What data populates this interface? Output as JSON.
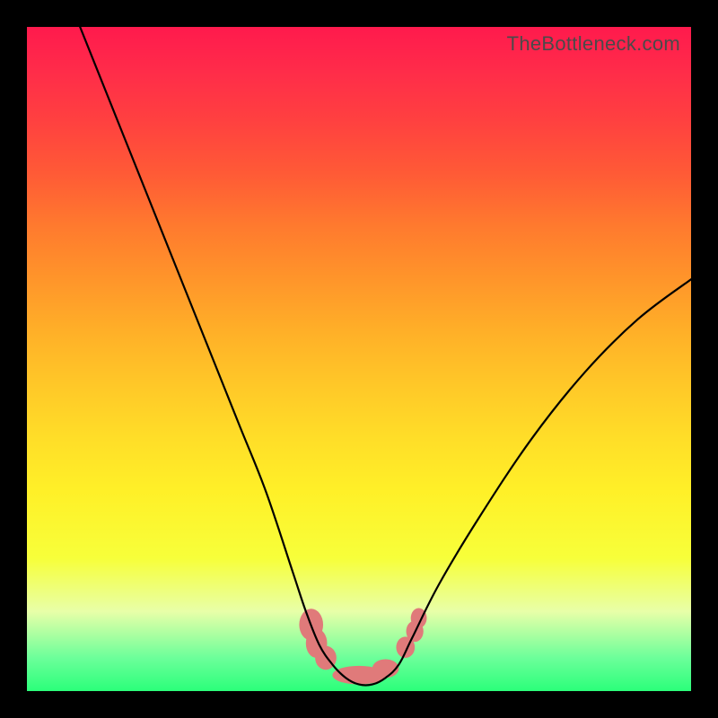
{
  "watermark": "TheBottleneck.com",
  "chart_data": {
    "type": "line",
    "title": "",
    "xlabel": "",
    "ylabel": "",
    "xlim": [
      0,
      100
    ],
    "ylim": [
      0,
      100
    ],
    "series": [
      {
        "name": "bottleneck-curve",
        "x": [
          8,
          12,
          16,
          20,
          24,
          28,
          32,
          36,
          40,
          42,
          44,
          46,
          48,
          50,
          52,
          54,
          56,
          58,
          62,
          68,
          76,
          84,
          92,
          100
        ],
        "y": [
          100,
          90,
          80,
          70,
          60,
          50,
          40,
          30,
          18,
          12,
          7,
          4,
          2,
          1,
          1,
          2,
          4,
          8,
          16,
          26,
          38,
          48,
          56,
          62
        ]
      }
    ],
    "markers": [
      {
        "name": "blob",
        "x": 42.8,
        "y": 10.0,
        "rx": 1.8,
        "ry": 2.4
      },
      {
        "name": "blob",
        "x": 43.6,
        "y": 7.2,
        "rx": 1.6,
        "ry": 2.2
      },
      {
        "name": "blob",
        "x": 45.0,
        "y": 5.0,
        "rx": 1.6,
        "ry": 1.8
      },
      {
        "name": "blob",
        "x": 50.0,
        "y": 2.4,
        "rx": 4.0,
        "ry": 1.4
      },
      {
        "name": "blob",
        "x": 54.0,
        "y": 3.4,
        "rx": 2.0,
        "ry": 1.4
      },
      {
        "name": "blob",
        "x": 57.0,
        "y": 6.6,
        "rx": 1.4,
        "ry": 1.6
      },
      {
        "name": "blob",
        "x": 58.4,
        "y": 9.0,
        "rx": 1.3,
        "ry": 1.6
      },
      {
        "name": "blob",
        "x": 59.0,
        "y": 11.0,
        "rx": 1.2,
        "ry": 1.5
      }
    ]
  }
}
